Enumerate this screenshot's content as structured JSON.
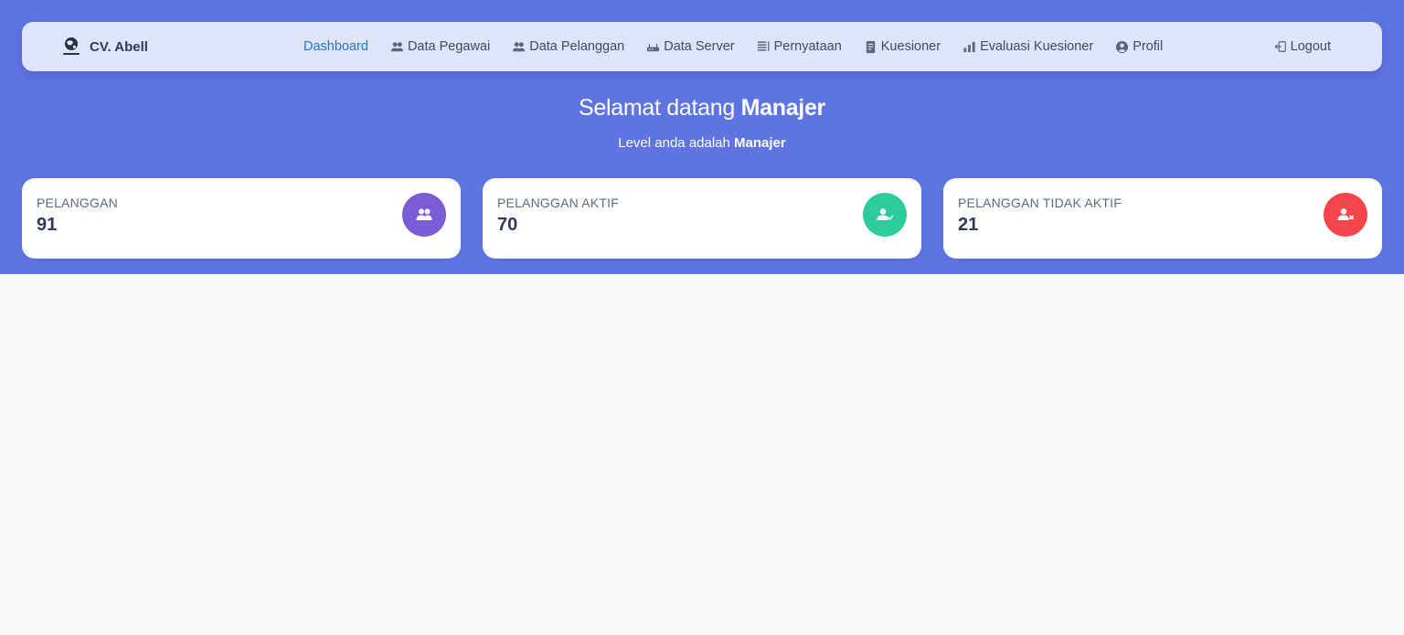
{
  "brand": {
    "name": "CV. Abell",
    "logo": "globe-logo-icon"
  },
  "nav": {
    "items": [
      {
        "label": "Dashboard",
        "icon": "",
        "active": true
      },
      {
        "label": "Data Pegawai",
        "icon": "users-icon"
      },
      {
        "label": "Data Pelanggan",
        "icon": "users-icon"
      },
      {
        "label": "Data Server",
        "icon": "server-icon"
      },
      {
        "label": "Pernyataan",
        "icon": "statement-icon"
      },
      {
        "label": "Kuesioner",
        "icon": "document-icon"
      },
      {
        "label": "Evaluasi Kuesioner",
        "icon": "bar-chart-icon"
      },
      {
        "label": "Profil",
        "icon": "user-circle-icon"
      }
    ],
    "logout": {
      "label": "Logout",
      "icon": "logout-icon"
    }
  },
  "welcome": {
    "prefix": "Selamat datang",
    "name": "Manajer",
    "level_prefix": "Level anda adalah",
    "level": "Manajer"
  },
  "cards": [
    {
      "title": "PELANGGAN",
      "value": "91",
      "icon": "users-icon",
      "color": "#7b5bd6"
    },
    {
      "title": "PELANGGAN AKTIF",
      "value": "70",
      "icon": "user-check-icon",
      "color": "#2ecc9a"
    },
    {
      "title": "PELANGGAN TIDAK AKTIF",
      "value": "21",
      "icon": "user-times-icon",
      "color": "#f5464b"
    }
  ],
  "colors": {
    "hero": "#5e74e3",
    "navbar": "#dfe4fb",
    "active": "#1f74d6",
    "page_bg": "#f8f9fb"
  }
}
